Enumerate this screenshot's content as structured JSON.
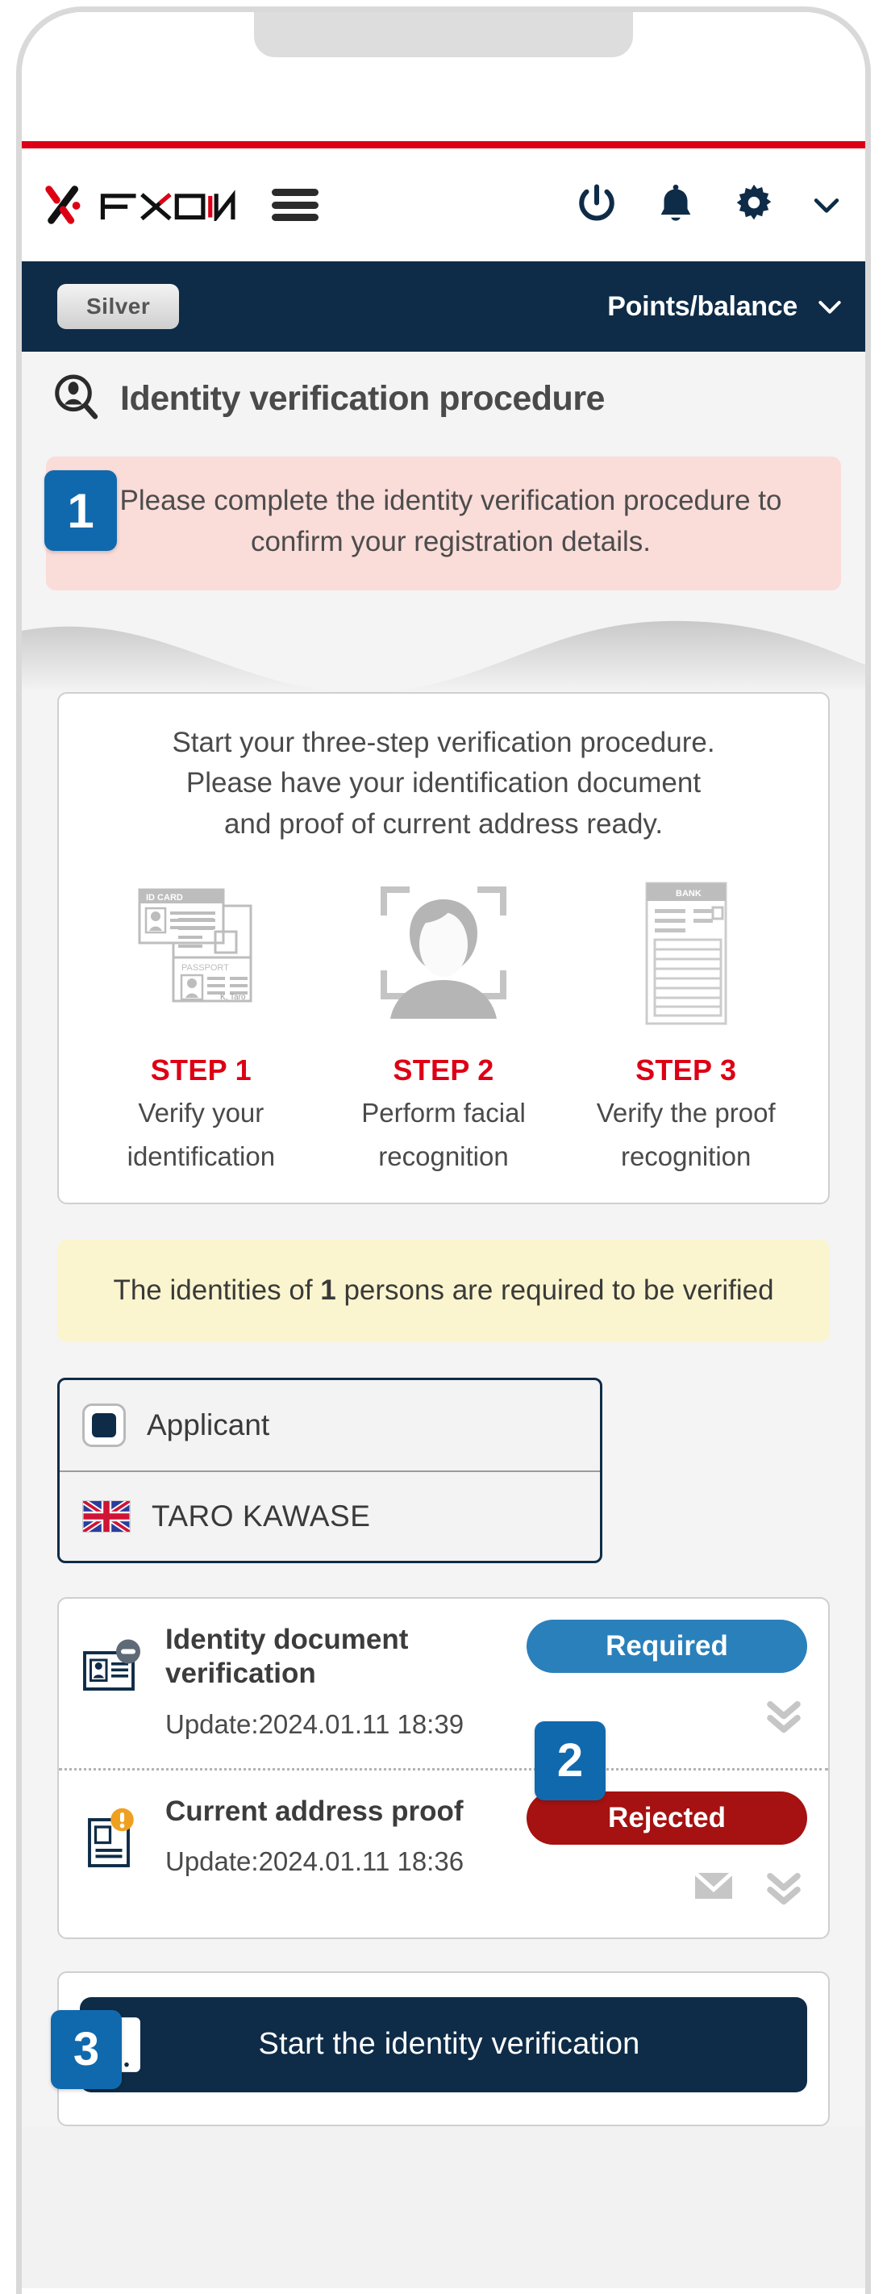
{
  "brand": {
    "logo_text": "FXON",
    "accent_red": "#dd0015",
    "navy": "#0e2c48",
    "blue_badge": "#1169ad"
  },
  "header": {
    "menu_icon": "hamburger-icon",
    "power_icon": "power-icon",
    "bell_icon": "bell-icon",
    "gear_icon": "gear-icon",
    "chevron_icon": "chevron-down-icon"
  },
  "nav": {
    "rank_label": "Silver",
    "points_label": "Points/balance",
    "points_chevron": "chevron-down-icon"
  },
  "page": {
    "title": "Identity verification procedure",
    "title_icon": "id-search-icon"
  },
  "alert": {
    "badge": "1",
    "text": "Please complete the identity verification procedure to confirm your registration details."
  },
  "intro": {
    "line1": "Start your three-step verification procedure.",
    "line2": "Please have your identification document",
    "line3": "and proof of current address ready."
  },
  "steps": [
    {
      "name": "STEP 1",
      "desc_line1": "Verify your",
      "desc_line2": "identification",
      "art": "id-card-passport-illustration",
      "art_labels": {
        "card": "ID CARD",
        "passport": "PASSPORT",
        "name": "K, Taro"
      }
    },
    {
      "name": "STEP 2",
      "desc_line1": "Perform facial",
      "desc_line2": "recognition",
      "art": "face-scan-illustration"
    },
    {
      "name": "STEP 3",
      "desc_line1": "Verify the proof",
      "desc_line2": "recognition",
      "art": "bank-statement-illustration",
      "art_labels": {
        "header": "BANK"
      }
    }
  ],
  "notice": {
    "prefix": "The identities of ",
    "count": "1",
    "suffix": " persons are required to be verified"
  },
  "applicant": {
    "role_label": "Applicant",
    "selected": true,
    "flag": "uk-flag-icon",
    "name": "TARO KAWASE"
  },
  "documents": [
    {
      "icon": "id-card-minus-icon",
      "title": "Identity document verification",
      "update": "Update:2024.01.11 18:39",
      "status": "Required",
      "status_color": "#2a80bb",
      "badge": "2",
      "actions": [
        "double-chevron-down-icon"
      ]
    },
    {
      "icon": "document-alert-icon",
      "title": "Current address proof",
      "update": "Update:2024.01.11 18:36",
      "status": "Rejected",
      "status_color": "#a61111",
      "actions": [
        "mail-icon",
        "double-chevron-down-icon"
      ]
    }
  ],
  "cta": {
    "badge": "3",
    "icon": "mobile-phone-icon",
    "label": "Start the identity verification"
  }
}
